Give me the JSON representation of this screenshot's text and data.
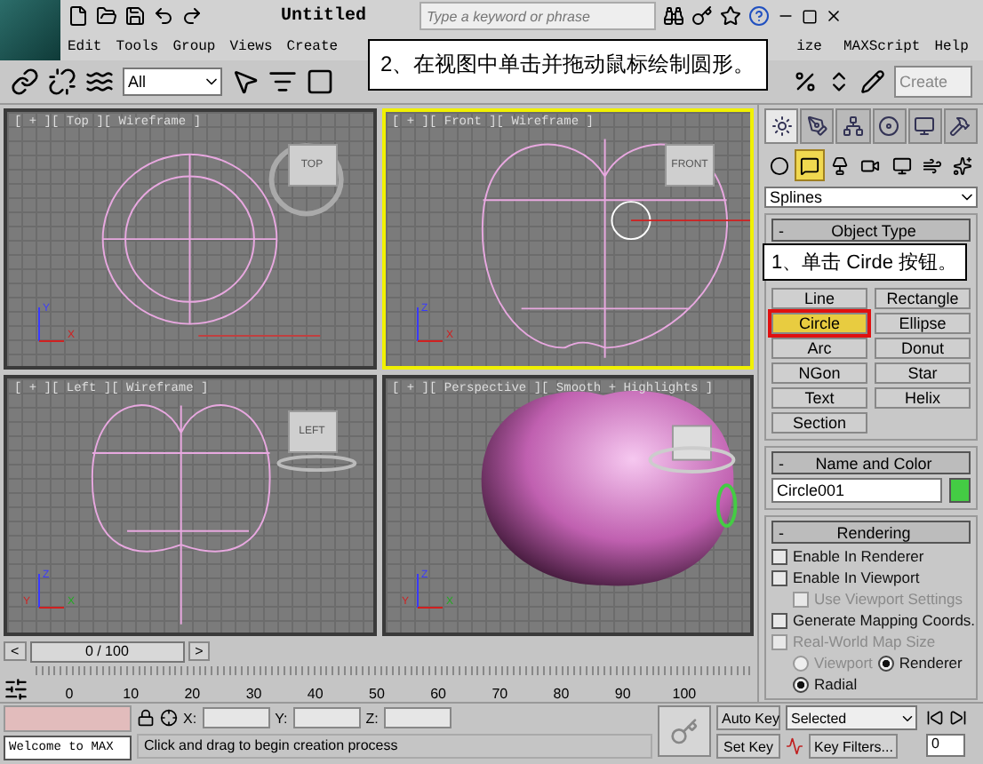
{
  "title_bar": {
    "title": "Untitled",
    "search": {
      "placeholder": "Type a keyword or phrase"
    }
  },
  "menu": [
    "Edit",
    "Tools",
    "Group",
    "Views",
    "Create",
    "ize",
    "MAXScript",
    "Help"
  ],
  "toolbar": {
    "filter": "All",
    "named_selection": "Create"
  },
  "viewports": [
    {
      "kind": "top",
      "label": "[ + ][ Top ][ Wireframe ]",
      "cube": "TOP",
      "axes": [
        "Y",
        "X"
      ],
      "active": false
    },
    {
      "kind": "front",
      "label": "[ + ][ Front ][ Wireframe ]",
      "cube": "FRONT",
      "axes": [
        "Z",
        "X"
      ],
      "active": true
    },
    {
      "kind": "left",
      "label": "[ + ][ Left ][ Wireframe ]",
      "cube": "LEFT",
      "axes": [
        "Z",
        "Y",
        "X"
      ],
      "active": false
    },
    {
      "kind": "perspective",
      "label": "[ + ][ Perspective ][ Smooth + Highlights ]",
      "axes": [
        "Z",
        "Y",
        "X"
      ],
      "active": false
    }
  ],
  "command_panel": {
    "tabs": [
      {
        "selected": true
      },
      {
        "selected": false
      },
      {
        "selected": false
      },
      {
        "selected": false
      },
      {
        "selected": false
      },
      {
        "selected": false
      }
    ],
    "categories": [
      {
        "selected": false
      },
      {
        "selected": true
      },
      {
        "selected": false
      },
      {
        "selected": false
      },
      {
        "selected": false
      },
      {
        "selected": false
      },
      {
        "selected": false
      }
    ],
    "dropdown": "Splines",
    "object_type": {
      "title": "Object Type",
      "collapse": "-",
      "buttons": [
        {
          "label": "Line",
          "selected": false,
          "highlighted": false
        },
        {
          "label": "Rectangle",
          "selected": false,
          "highlighted": false
        },
        {
          "label": "Circle",
          "selected": true,
          "highlighted": true
        },
        {
          "label": "Ellipse",
          "selected": false,
          "highlighted": false
        },
        {
          "label": "Arc",
          "selected": false,
          "highlighted": false
        },
        {
          "label": "Donut",
          "selected": false,
          "highlighted": false
        },
        {
          "label": "NGon",
          "selected": false,
          "highlighted": false
        },
        {
          "label": "Star",
          "selected": false,
          "highlighted": false
        },
        {
          "label": "Text",
          "selected": false,
          "highlighted": false
        },
        {
          "label": "Helix",
          "selected": false,
          "highlighted": false
        },
        {
          "label": "Section",
          "selected": false,
          "highlighted": false
        }
      ]
    },
    "name_and_color": {
      "title": "Name and Color",
      "collapse": "-",
      "name": "Circle001",
      "color": "#44cc44"
    },
    "rendering": {
      "title": "Rendering",
      "collapse": "-",
      "options": [
        {
          "kind": "checkbox",
          "label": "Enable In Renderer",
          "checked": false,
          "disabled": false
        },
        {
          "kind": "checkbox",
          "label": "Enable In Viewport",
          "checked": false,
          "disabled": false,
          "children": [
            {
              "kind": "checkbox",
              "label": "Use Viewport Settings",
              "checked": false,
              "disabled": true
            }
          ]
        },
        {
          "kind": "checkbox",
          "label": "Generate Mapping Coords.",
          "checked": false,
          "disabled": false
        },
        {
          "kind": "checkbox",
          "label": "Real-World Map Size",
          "checked": false,
          "disabled": true
        },
        {
          "kind": "radios",
          "items": [
            {
              "label": "Viewport",
              "selected": false,
              "disabled": true
            },
            {
              "label": "Renderer",
              "selected": true,
              "disabled": false
            }
          ]
        },
        {
          "kind": "radios",
          "items": [
            {
              "label": "Radial",
              "selected": true,
              "disabled": false
            }
          ]
        }
      ]
    }
  },
  "timeline": {
    "position": "0 / 100",
    "level": 0,
    "prev": "<",
    "next": ">",
    "ticks": [
      "0",
      "10",
      "20",
      "30",
      "40",
      "50",
      "60",
      "70",
      "80",
      "90",
      "100"
    ]
  },
  "status": {
    "listener": "Welcome to MAX",
    "prompt": "Click and drag to begin creation process",
    "coords": [
      "X:",
      "Y:",
      "Z:"
    ],
    "auto_key": "Auto Key",
    "set_key": "Set Key",
    "key_mode": "Selected",
    "key_filters": "Key Filters...",
    "frame": "0"
  },
  "callouts": [
    {
      "text": "2、在视图中单击并拖动鼠标绘制圆形。"
    },
    {
      "text": "1、单击 Cirde 按钮。"
    }
  ]
}
